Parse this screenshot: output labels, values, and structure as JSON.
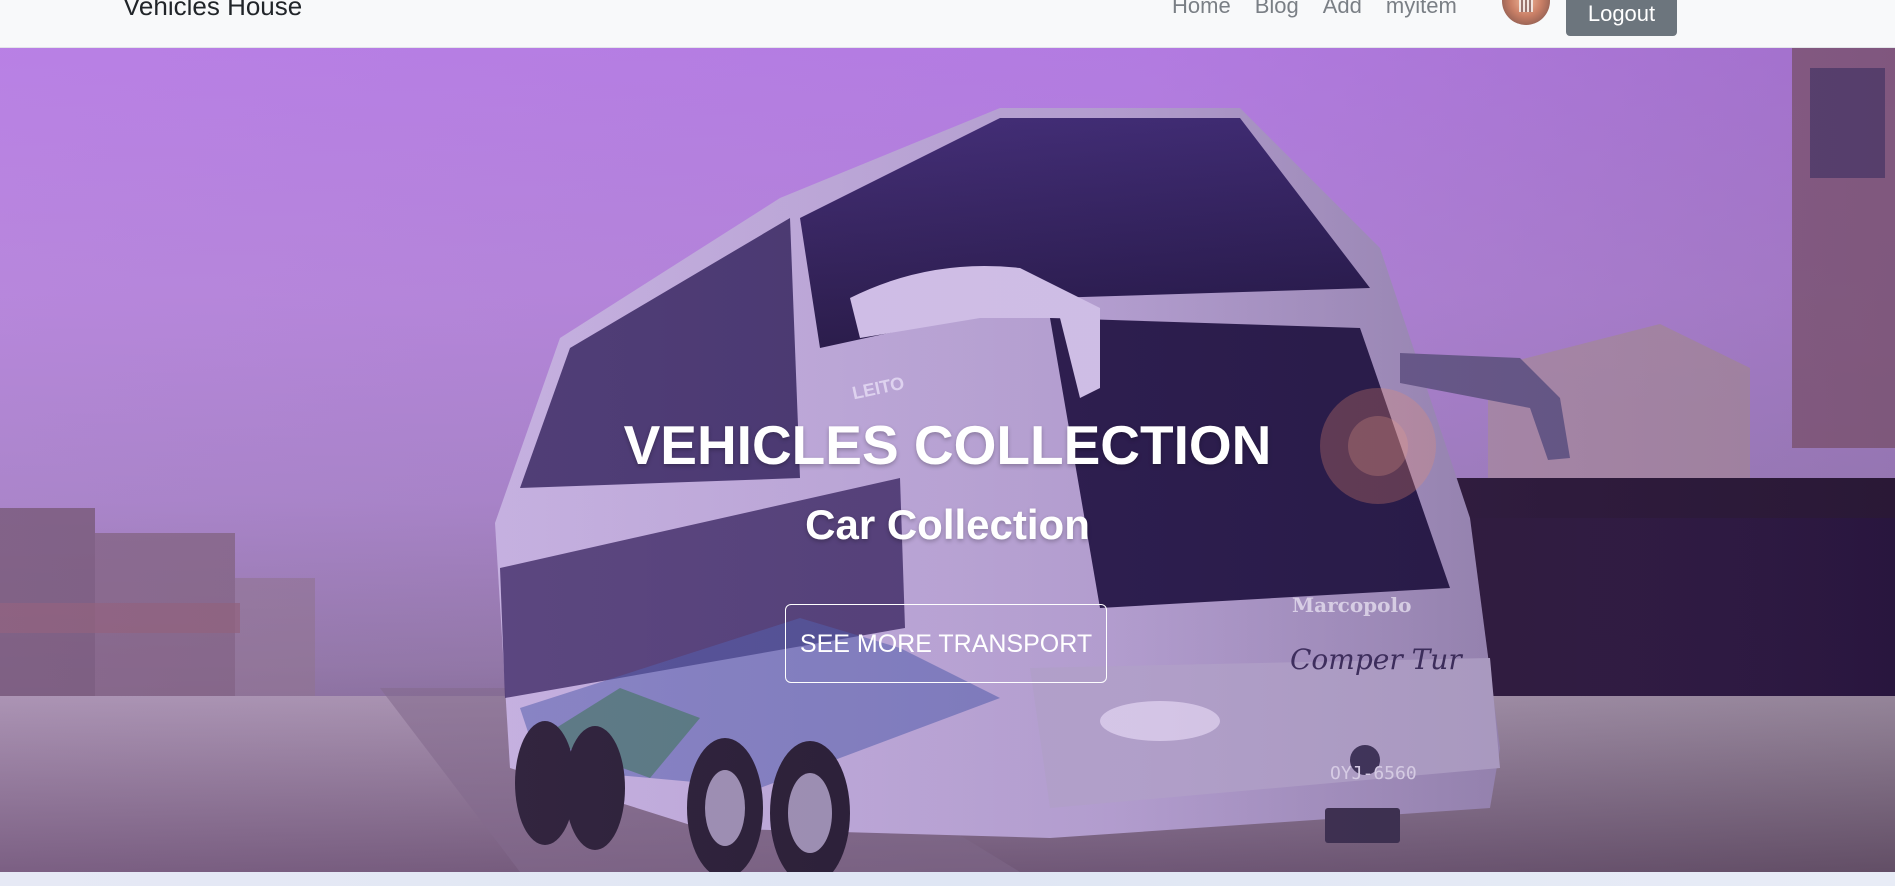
{
  "navbar": {
    "brand": "Vehicles House",
    "links": [
      "Home",
      "Blog",
      "Add",
      "myitem"
    ],
    "logout_label": "Logout"
  },
  "hero": {
    "title": "VEHICLES COLLECTION",
    "subtitle": "Car Collection",
    "cta_label": "SEE MORE TRANSPORT",
    "bus_brand": "Marcopolo",
    "bus_livery": "Comper Tur",
    "bus_plate": "OYJ-6560",
    "bus_class": "LEITO"
  },
  "colors": {
    "navbar_bg": "#f8f9fa",
    "logout_bg": "#6c757d",
    "hero_tint": "#b982e4"
  },
  "icons": {
    "avatar": "user-avatar-image"
  }
}
